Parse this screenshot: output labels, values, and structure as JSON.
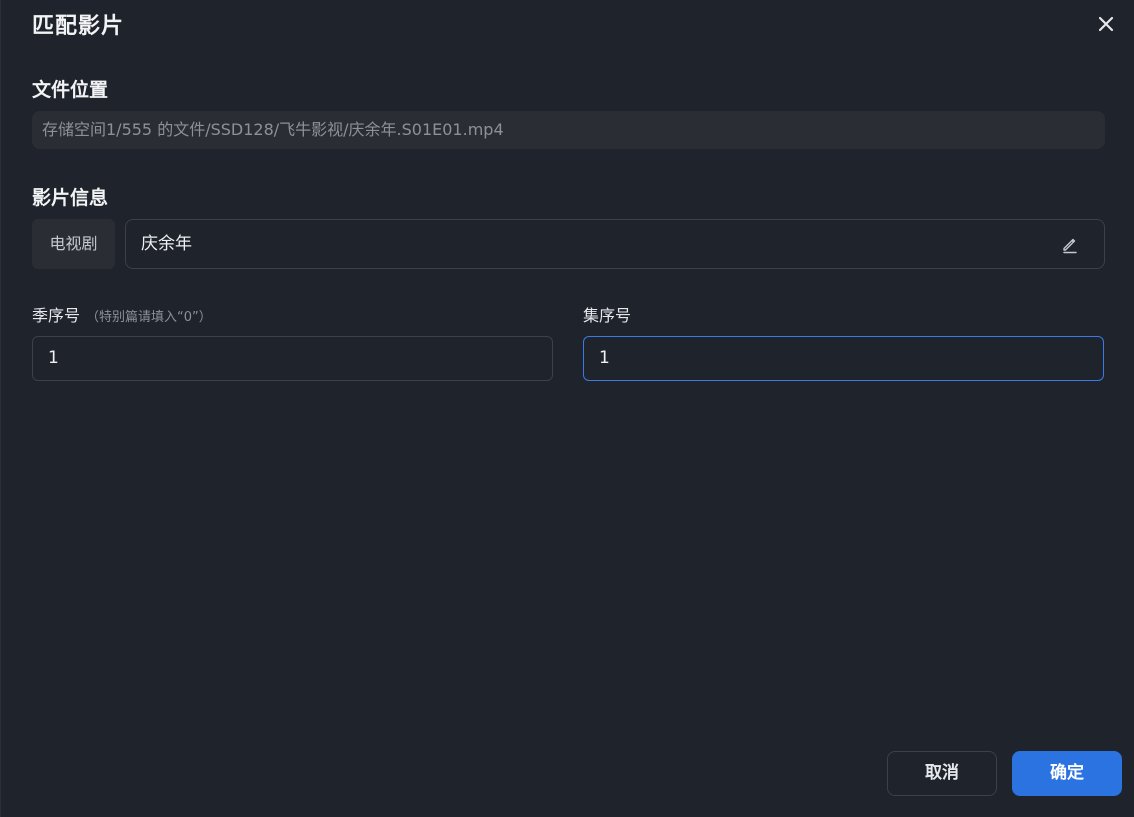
{
  "dialog": {
    "title": "匹配影片"
  },
  "file_location": {
    "label": "文件位置",
    "path": "存储空间1/555 的文件/SSD128/飞牛影视/庆余年.S01E01.mp4"
  },
  "media_info": {
    "label": "影片信息",
    "type": "电视剧",
    "title": "庆余年"
  },
  "season": {
    "label": "季序号",
    "hint": "（特别篇请填入“0”）",
    "value": "1"
  },
  "episode": {
    "label": "集序号",
    "value": "1"
  },
  "footer": {
    "cancel_label": "取消",
    "confirm_label": "确定"
  },
  "icons": {
    "close": "close-icon",
    "edit": "edit-pencil-icon"
  },
  "colors": {
    "background": "#1f232b",
    "accent": "#2b73e0",
    "focus_border": "#3a7be6",
    "muted_text": "#8c9199"
  }
}
